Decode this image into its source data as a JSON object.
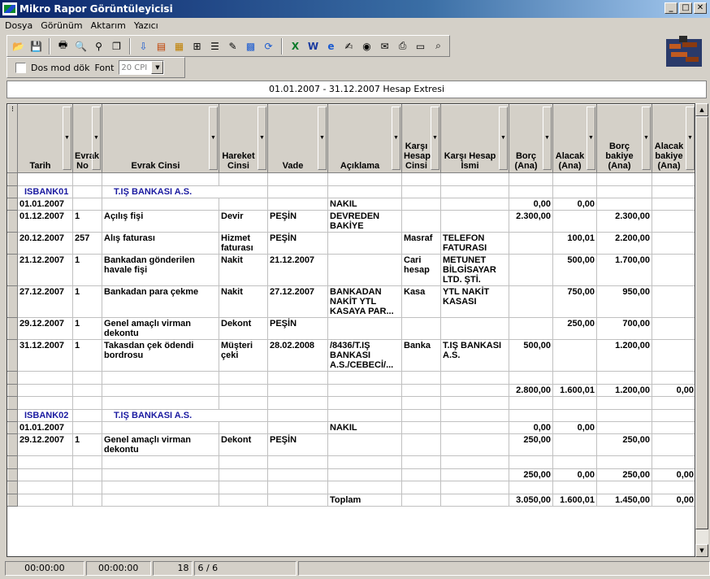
{
  "window": {
    "title": "Mikro Rapor Görüntüleyicisi",
    "min": "_",
    "max": "□",
    "close": "✕"
  },
  "menu": [
    "Dosya",
    "Görünüm",
    "Aktarım",
    "Yazıcı"
  ],
  "options": {
    "dos_mod_label": "Dos mod dök",
    "font_label": "Font",
    "font_value": "20 CPI"
  },
  "report_title": "01.01.2007 - 31.12.2007 Hesap Extresi",
  "columns": [
    "Tarih",
    "Evrak No",
    "Evrak Cinsi",
    "Hareket Cinsi",
    "Vade",
    "Açıklama",
    "Karşı Hesap Cinsi",
    "Karşı Hesap İsmi",
    "Borç (Ana)",
    "Alacak (Ana)",
    "Borç bakiye (Ana)",
    "Alacak bakiye (Ana)"
  ],
  "rows": [
    {
      "type": "blank",
      "cells": [
        "",
        "",
        "",
        "",
        "",
        "",
        "",
        "",
        "",
        "",
        "",
        ""
      ]
    },
    {
      "type": "group",
      "cells": [
        "ISBANK01",
        "",
        "T.IŞ BANKASI A.S.",
        "",
        "",
        "",
        "",
        "",
        "",
        "",
        "",
        ""
      ]
    },
    {
      "type": "data",
      "cells": [
        "01.01.2007",
        "",
        "",
        "",
        "",
        "NAKIL",
        "",
        "",
        "0,00",
        "0,00",
        "",
        ""
      ]
    },
    {
      "type": "data",
      "cells": [
        "01.12.2007",
        "1",
        "Açılış fişi",
        "Devir",
        "PEŞİN",
        "DEVREDEN BAKİYE",
        "",
        "",
        "2.300,00",
        "",
        "2.300,00",
        ""
      ]
    },
    {
      "type": "data",
      "cells": [
        "20.12.2007",
        "257",
        "Alış faturası",
        "Hizmet faturası",
        "PEŞİN",
        "",
        "Masraf",
        "TELEFON FATURASI",
        "",
        "100,01",
        "2.200,00",
        ""
      ]
    },
    {
      "type": "data",
      "cells": [
        "21.12.2007",
        "1",
        "Bankadan gönderilen havale fişi",
        "Nakit",
        "21.12.2007",
        "",
        "Cari hesap",
        "METUNET BİLGİSAYAR LTD. ŞTİ.",
        "",
        "500,00",
        "1.700,00",
        ""
      ]
    },
    {
      "type": "data",
      "cells": [
        "27.12.2007",
        "1",
        "Bankadan para çekme",
        "Nakit",
        "27.12.2007",
        "BANKADAN NAKİT YTL KASAYA PAR...",
        "Kasa",
        "YTL NAKİT KASASI",
        "",
        "750,00",
        "950,00",
        ""
      ]
    },
    {
      "type": "data",
      "cells": [
        "29.12.2007",
        "1",
        "Genel amaçlı virman dekontu",
        "Dekont",
        "PEŞİN",
        "",
        "",
        "",
        "",
        "250,00",
        "700,00",
        ""
      ]
    },
    {
      "type": "data",
      "cells": [
        "31.12.2007",
        "1",
        "Takasdan çek ödendi bordrosu",
        "Müşteri çeki",
        "28.02.2008",
        "/8436/T.IŞ BANKASI A.S./CEBECİ/...",
        "Banka",
        "T.IŞ BANKASI A.S.",
        "500,00",
        "",
        "1.200,00",
        ""
      ]
    },
    {
      "type": "blank",
      "cells": [
        "",
        "",
        "",
        "",
        "",
        "",
        "",
        "",
        "",
        "",
        "",
        ""
      ]
    },
    {
      "type": "total",
      "cells": [
        "",
        "",
        "",
        "",
        "",
        "",
        "",
        "",
        "2.800,00",
        "1.600,01",
        "1.200,00",
        "0,00"
      ]
    },
    {
      "type": "blank",
      "cells": [
        "",
        "",
        "",
        "",
        "",
        "",
        "",
        "",
        "",
        "",
        "",
        ""
      ]
    },
    {
      "type": "group",
      "cells": [
        "ISBANK02",
        "",
        "T.IŞ BANKASI A.S.",
        "",
        "",
        "",
        "",
        "",
        "",
        "",
        "",
        ""
      ]
    },
    {
      "type": "data",
      "cells": [
        "01.01.2007",
        "",
        "",
        "",
        "",
        "NAKIL",
        "",
        "",
        "0,00",
        "0,00",
        "",
        ""
      ]
    },
    {
      "type": "data",
      "cells": [
        "29.12.2007",
        "1",
        "Genel amaçlı virman dekontu",
        "Dekont",
        "PEŞİN",
        "",
        "",
        "",
        "250,00",
        "",
        "250,00",
        ""
      ]
    },
    {
      "type": "blank",
      "cells": [
        "",
        "",
        "",
        "",
        "",
        "",
        "",
        "",
        "",
        "",
        "",
        ""
      ]
    },
    {
      "type": "total",
      "cells": [
        "",
        "",
        "",
        "",
        "",
        "",
        "",
        "",
        "250,00",
        "0,00",
        "250,00",
        "0,00"
      ]
    },
    {
      "type": "blank",
      "cells": [
        "",
        "",
        "",
        "",
        "",
        "",
        "",
        "",
        "",
        "",
        "",
        ""
      ]
    },
    {
      "type": "total",
      "cells": [
        "",
        "",
        "",
        "",
        "",
        "Toplam",
        "",
        "",
        "3.050,00",
        "1.600,01",
        "1.450,00",
        "0,00"
      ]
    }
  ],
  "status": {
    "t1": "00:00:00",
    "t2": "00:00:00",
    "count": "18",
    "pages": "6 / 6"
  }
}
